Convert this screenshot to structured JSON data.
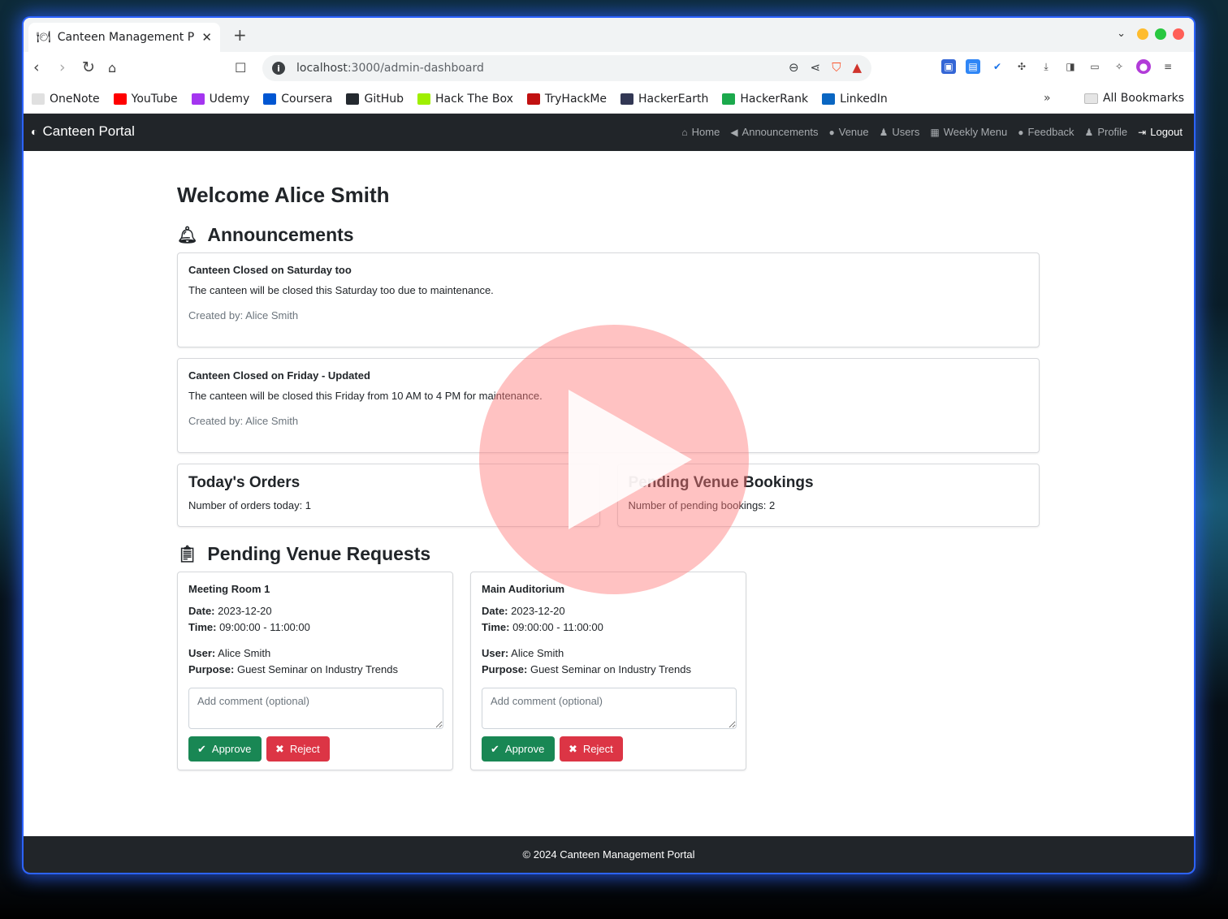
{
  "browser": {
    "tab_title": "Canteen Management P",
    "new_tab": "+",
    "url_host": "localhost",
    "url_path": ":3000/admin-dashboard",
    "bookmarks": [
      {
        "label": "OneNote",
        "color": "#e0e0e0"
      },
      {
        "label": "YouTube",
        "color": "#ff0000"
      },
      {
        "label": "Udemy",
        "color": "#a435f0"
      },
      {
        "label": "Coursera",
        "color": "#0056d2"
      },
      {
        "label": "GitHub",
        "color": "#24292f"
      },
      {
        "label": "Hack The Box",
        "color": "#9fef00"
      },
      {
        "label": "TryHackMe",
        "color": "#c11111"
      },
      {
        "label": "HackerEarth",
        "color": "#323754"
      },
      {
        "label": "HackerRank",
        "color": "#1ba94c"
      },
      {
        "label": "LinkedIn",
        "color": "#0a66c2"
      }
    ],
    "bookmarks_more": "»",
    "all_bookmarks": "All Bookmarks"
  },
  "nav": {
    "brand": "Canteen Portal",
    "links": [
      {
        "label": "Home",
        "icon": "home-icon",
        "glyph": "⌂"
      },
      {
        "label": "Announcements",
        "icon": "megaphone-icon",
        "glyph": "◀"
      },
      {
        "label": "Venue",
        "icon": "map-pin-icon",
        "glyph": "●"
      },
      {
        "label": "Users",
        "icon": "users-icon",
        "glyph": "♟"
      },
      {
        "label": "Weekly Menu",
        "icon": "calendar-icon",
        "glyph": "▦"
      },
      {
        "label": "Feedback",
        "icon": "comment-icon",
        "glyph": "●"
      },
      {
        "label": "Profile",
        "icon": "user-icon",
        "glyph": "♟"
      },
      {
        "label": "Logout",
        "icon": "logout-icon",
        "glyph": "⇥"
      }
    ]
  },
  "page": {
    "welcome": "Welcome Alice Smith",
    "announcements_heading": "Announcements",
    "announcements": [
      {
        "title": "Canteen Closed on Saturday too",
        "text": "The canteen will be closed this Saturday too due to maintenance.",
        "created_by": "Created by: Alice Smith"
      },
      {
        "title": "Canteen Closed on Friday - Updated",
        "text": "The canteen will be closed this Friday from 10 AM to 4 PM for maintenance.",
        "created_by": "Created by: Alice Smith"
      }
    ],
    "stats": {
      "orders_title": "Today's Orders",
      "orders_text": "Number of orders today: 1",
      "bookings_title": "Pending Venue Bookings",
      "bookings_text": "Number of pending bookings: 2"
    },
    "requests_heading": "Pending Venue Requests",
    "requests": [
      {
        "venue": "Meeting Room 1",
        "date_label": "Date:",
        "date": "2023-12-20",
        "time_label": "Time:",
        "time": "09:00:00 - 11:00:00",
        "user_label": "User:",
        "user": "Alice Smith",
        "purpose_label": "Purpose:",
        "purpose": "Guest Seminar on Industry Trends",
        "comment_placeholder": "Add comment (optional)",
        "approve": "Approve",
        "reject": "Reject"
      },
      {
        "venue": "Main Auditorium",
        "date_label": "Date:",
        "date": "2023-12-20",
        "time_label": "Time:",
        "time": "09:00:00 - 11:00:00",
        "user_label": "User:",
        "user": "Alice Smith",
        "purpose_label": "Purpose:",
        "purpose": "Guest Seminar on Industry Trends",
        "comment_placeholder": "Add comment (optional)",
        "approve": "Approve",
        "reject": "Reject"
      }
    ],
    "footer": "© 2024 Canteen Management Portal"
  },
  "colors": {
    "navbar": "#212529",
    "approve": "#198754",
    "reject": "#dc3545",
    "window_glow": "#2c63ff"
  }
}
